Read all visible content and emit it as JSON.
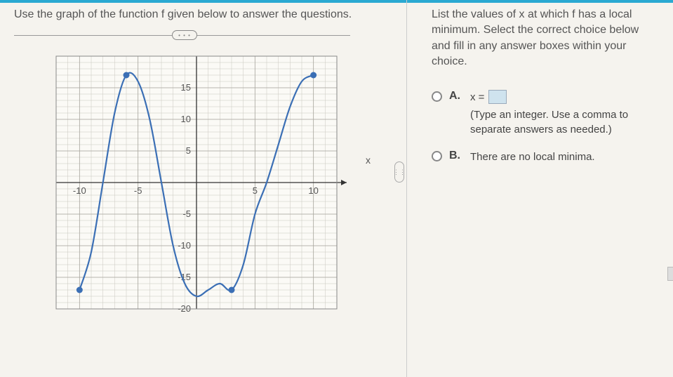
{
  "left": {
    "prompt": "Use the graph of the function f given below to answer the questions.",
    "ellipsis": "• • •",
    "x_axis_label": "x"
  },
  "right": {
    "question": "List the values of x at which f has a local minimum. Select the correct choice below and fill in any answer boxes within your choice.",
    "choice_a_letter": "A.",
    "choice_a_eq_lhs": "x =",
    "choice_a_hint": "(Type an integer. Use a comma to separate answers as needed.)",
    "choice_b_letter": "B.",
    "choice_b_text": "There are no local minima."
  },
  "chart_data": {
    "type": "line",
    "title": "",
    "xlabel": "x",
    "ylabel": "",
    "xlim": [
      -12,
      12
    ],
    "ylim": [
      -20,
      20
    ],
    "x_ticks": [
      -10,
      -5,
      5,
      10
    ],
    "y_ticks": [
      -20,
      -15,
      -10,
      -5,
      5,
      10,
      15
    ],
    "grid": true,
    "series": [
      {
        "name": "f",
        "points": [
          {
            "x": -10,
            "y": -17
          },
          {
            "x": -9,
            "y": -11
          },
          {
            "x": -8,
            "y": 0
          },
          {
            "x": -7,
            "y": 11
          },
          {
            "x": -6,
            "y": 17
          },
          {
            "x": -5,
            "y": 16
          },
          {
            "x": -4,
            "y": 10
          },
          {
            "x": -3,
            "y": 0
          },
          {
            "x": -2,
            "y": -10
          },
          {
            "x": -1,
            "y": -16
          },
          {
            "x": 0,
            "y": -18
          },
          {
            "x": 1,
            "y": -17
          },
          {
            "x": 2,
            "y": -16
          },
          {
            "x": 3,
            "y": -17
          },
          {
            "x": 4,
            "y": -13
          },
          {
            "x": 5,
            "y": -5
          },
          {
            "x": 6,
            "y": 0
          },
          {
            "x": 7,
            "y": 6
          },
          {
            "x": 8,
            "y": 12
          },
          {
            "x": 9,
            "y": 16
          },
          {
            "x": 10,
            "y": 17
          }
        ],
        "endpoints_marked": [
          {
            "x": -10,
            "y": -17
          },
          {
            "x": -6,
            "y": 17
          },
          {
            "x": 3,
            "y": -17
          },
          {
            "x": 10,
            "y": 17
          }
        ]
      }
    ]
  }
}
